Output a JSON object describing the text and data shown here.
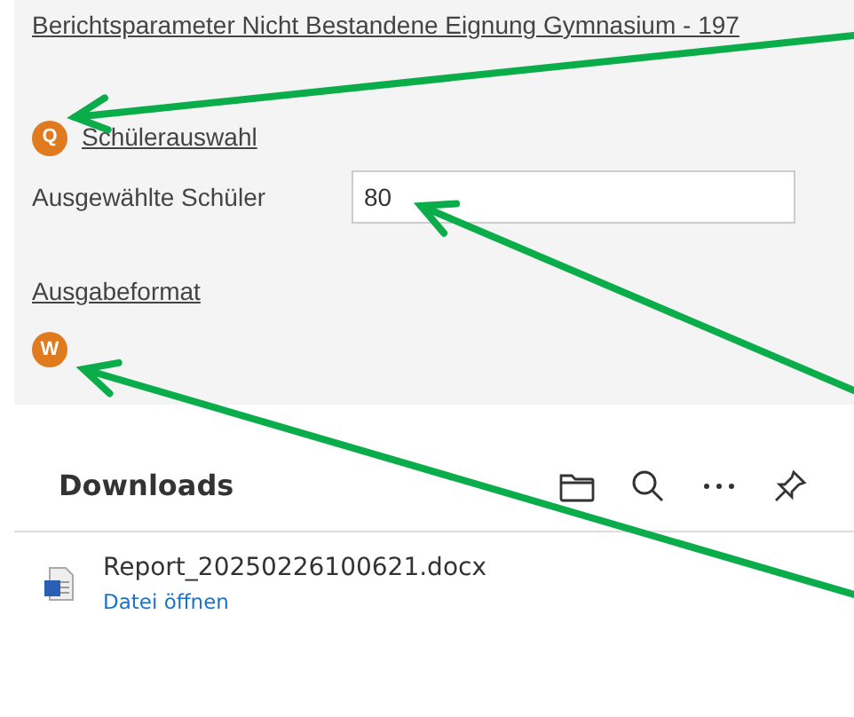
{
  "report_panel": {
    "title": "Berichtsparameter Nicht Bestandene Eignung Gymnasium - 197",
    "student_selection": {
      "icon_letter": "Q",
      "link": "Schülerauswahl"
    },
    "selected_students": {
      "label": "Ausgewählte Schüler",
      "value": "80"
    },
    "output_format": {
      "link": "Ausgabeformat",
      "icon_letter": "W"
    }
  },
  "downloads": {
    "title": "Downloads",
    "items": [
      {
        "filename": "Report_20250226100621.docx",
        "action": "Datei öffnen"
      }
    ]
  },
  "annotations": [
    {
      "kind": "arrow"
    },
    {
      "kind": "arrow"
    },
    {
      "kind": "arrow"
    }
  ]
}
